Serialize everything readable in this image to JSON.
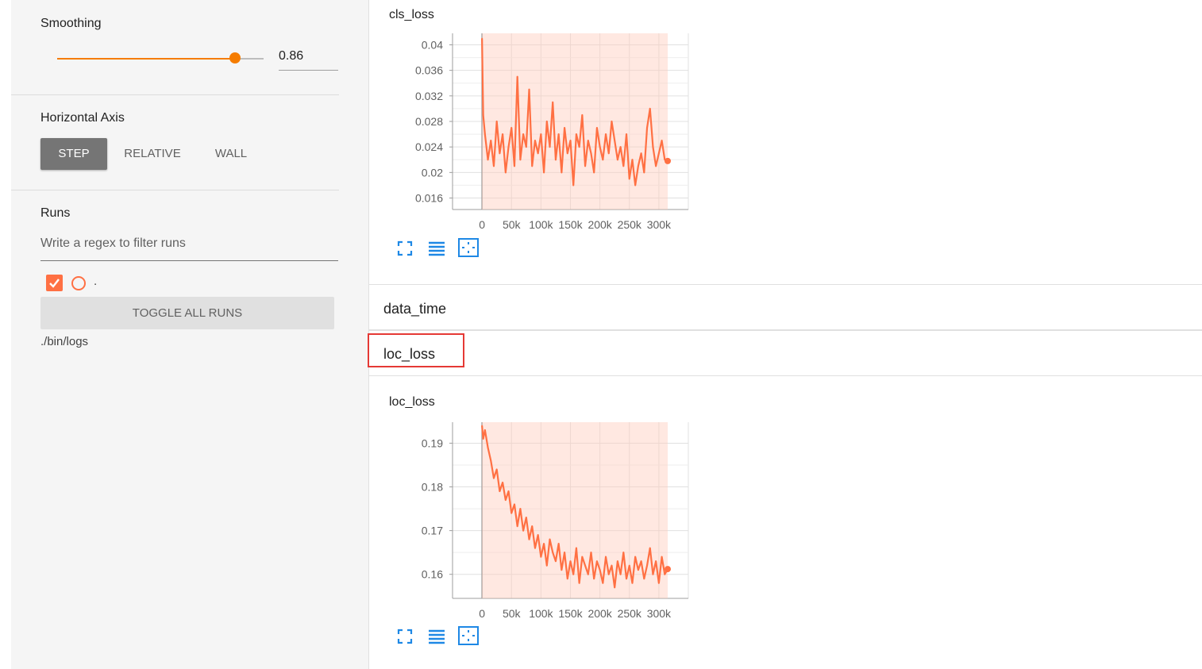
{
  "sidebar": {
    "smoothing": {
      "label": "Smoothing",
      "value": 0.86,
      "value_text": "0.86"
    },
    "horizontal_axis": {
      "label": "Horizontal Axis",
      "options": [
        "STEP",
        "RELATIVE",
        "WALL"
      ],
      "selected": "STEP"
    },
    "runs": {
      "label": "Runs",
      "filter_placeholder": "Write a regex to filter runs",
      "items": [
        {
          "name": ".",
          "checked": true
        }
      ],
      "toggle_label": "TOGGLE ALL RUNS",
      "logdir": "./bin/logs"
    }
  },
  "main": {
    "categories": [
      {
        "label": "data_time"
      },
      {
        "label": "loc_loss"
      }
    ]
  },
  "colors": {
    "accent": "#f57c00",
    "series": "#ff7043",
    "series_raw": "#ffccbc",
    "highlight": "#e53935",
    "icon_blue": "#1e88e5"
  },
  "chart_data": [
    {
      "type": "line",
      "title": "cls_loss",
      "xlabel": "",
      "ylabel": "",
      "x_ticks": [
        "0",
        "50k",
        "100k",
        "150k",
        "200k",
        "250k",
        "300k"
      ],
      "y_ticks": [
        "0.04",
        "0.036",
        "0.032",
        "0.028",
        "0.024",
        "0.02",
        "0.016"
      ],
      "xlim": [
        -50000,
        350000
      ],
      "ylim": [
        0.0142,
        0.0418
      ],
      "series": [
        {
          "smoothed": true,
          "x": [
            0,
            2000,
            5000,
            10000,
            15000,
            20000,
            25000,
            30000,
            35000,
            40000,
            45000,
            50000,
            55000,
            60000,
            65000,
            70000,
            75000,
            80000,
            85000,
            90000,
            95000,
            100000,
            105000,
            110000,
            115000,
            120000,
            125000,
            130000,
            135000,
            140000,
            145000,
            150000,
            155000,
            160000,
            165000,
            170000,
            175000,
            180000,
            185000,
            190000,
            195000,
            200000,
            205000,
            210000,
            215000,
            220000,
            225000,
            230000,
            235000,
            240000,
            245000,
            250000,
            255000,
            260000,
            265000,
            270000,
            275000,
            280000,
            285000,
            290000,
            295000,
            300000,
            305000,
            310000,
            315000
          ],
          "y": [
            0.041,
            0.029,
            0.026,
            0.022,
            0.025,
            0.021,
            0.028,
            0.023,
            0.026,
            0.02,
            0.024,
            0.027,
            0.021,
            0.035,
            0.022,
            0.026,
            0.024,
            0.033,
            0.021,
            0.025,
            0.023,
            0.026,
            0.02,
            0.028,
            0.024,
            0.031,
            0.022,
            0.026,
            0.02,
            0.027,
            0.023,
            0.025,
            0.018,
            0.026,
            0.024,
            0.029,
            0.021,
            0.025,
            0.023,
            0.02,
            0.027,
            0.024,
            0.022,
            0.026,
            0.023,
            0.028,
            0.025,
            0.022,
            0.024,
            0.021,
            0.026,
            0.019,
            0.022,
            0.018,
            0.021,
            0.023,
            0.02,
            0.027,
            0.03,
            0.024,
            0.021,
            0.023,
            0.025,
            0.022,
            0.0218
          ]
        }
      ]
    },
    {
      "type": "line",
      "title": "loc_loss",
      "xlabel": "",
      "ylabel": "",
      "x_ticks": [
        "0",
        "50k",
        "100k",
        "150k",
        "200k",
        "250k",
        "300k"
      ],
      "y_ticks": [
        "0.19",
        "0.18",
        "0.17",
        "0.16"
      ],
      "xlim": [
        -50000,
        350000
      ],
      "ylim": [
        0.1545,
        0.1948
      ],
      "series": [
        {
          "smoothed": true,
          "x": [
            0,
            2000,
            5000,
            10000,
            15000,
            20000,
            25000,
            30000,
            35000,
            40000,
            45000,
            50000,
            55000,
            60000,
            65000,
            70000,
            75000,
            80000,
            85000,
            90000,
            95000,
            100000,
            105000,
            110000,
            115000,
            120000,
            125000,
            130000,
            135000,
            140000,
            145000,
            150000,
            155000,
            160000,
            165000,
            170000,
            175000,
            180000,
            185000,
            190000,
            195000,
            200000,
            205000,
            210000,
            215000,
            220000,
            225000,
            230000,
            235000,
            240000,
            245000,
            250000,
            255000,
            260000,
            265000,
            270000,
            275000,
            280000,
            285000,
            290000,
            295000,
            300000,
            305000,
            310000,
            315000
          ],
          "y": [
            0.194,
            0.191,
            0.193,
            0.189,
            0.186,
            0.182,
            0.184,
            0.179,
            0.181,
            0.177,
            0.179,
            0.174,
            0.176,
            0.171,
            0.175,
            0.17,
            0.173,
            0.168,
            0.171,
            0.166,
            0.169,
            0.164,
            0.167,
            0.162,
            0.168,
            0.165,
            0.163,
            0.167,
            0.161,
            0.165,
            0.159,
            0.163,
            0.16,
            0.166,
            0.158,
            0.164,
            0.162,
            0.16,
            0.165,
            0.159,
            0.163,
            0.161,
            0.158,
            0.164,
            0.16,
            0.162,
            0.157,
            0.163,
            0.16,
            0.165,
            0.159,
            0.162,
            0.158,
            0.164,
            0.161,
            0.163,
            0.159,
            0.162,
            0.166,
            0.16,
            0.163,
            0.158,
            0.164,
            0.16,
            0.1612
          ]
        }
      ]
    }
  ]
}
